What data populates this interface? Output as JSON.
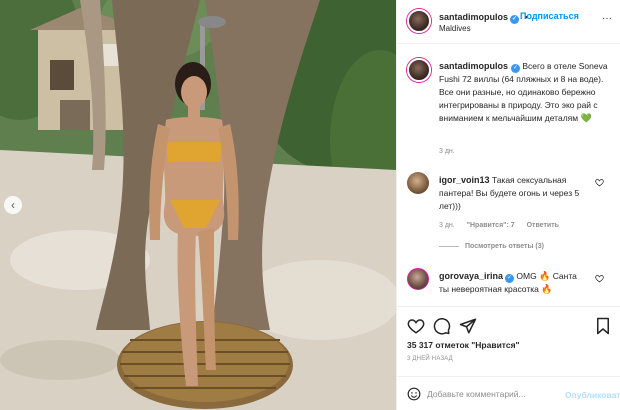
{
  "post": {
    "image_alt_subject": "woman-in-bikini-photo",
    "carousel_prev_icon": "‹"
  },
  "header": {
    "username": "santadimopulos",
    "verified_mark": "✓",
    "separator": "•",
    "follow_label": "Подписаться",
    "location": "Maldives",
    "more_icon": "···"
  },
  "caption": {
    "username": "santadimopulos",
    "verified_mark": "✓",
    "text": "Всего в отеле Soneva Fushi 72 виллы (64 пляжных и 8 на воде). Все они разные, но одинаково бережно интегрированы в природу. Это эко рай с вниманием к мельчайшим деталям",
    "emoji": "💚",
    "time": "3 дн."
  },
  "comments": [
    {
      "username": "igor_voin13",
      "text": "Такая сексуальная пантера! Вы будете огонь и через 5 лет)))",
      "time": "3 дн.",
      "likes": "\"Нравится\": 7",
      "reply": "Ответить",
      "view_replies": "Посмотреть ответы (3)"
    },
    {
      "username": "gorovaya_irina",
      "verified_mark": "✓",
      "text": "OMG",
      "text2": "Санта ты невероятная красотка",
      "emoji": "🔥"
    }
  ],
  "actions": {
    "like_icon": "heart-icon",
    "comment_icon": "comment-icon",
    "share_icon": "share-icon",
    "save_icon": "bookmark-icon"
  },
  "stats": {
    "likes_text": "35 317 отметок \"Нравится\"",
    "date_text": "3 ДНЕЙ НАЗАД"
  },
  "comment_input": {
    "placeholder": "Добавьте комментарий...",
    "publish_label": "Опубликовать"
  },
  "colors": {
    "link_blue": "#0095f6",
    "verified_blue": "#3897f0",
    "muted_gray": "#8e8e8e",
    "text_dark": "#262626",
    "publish_disabled": "#b2dffc"
  }
}
